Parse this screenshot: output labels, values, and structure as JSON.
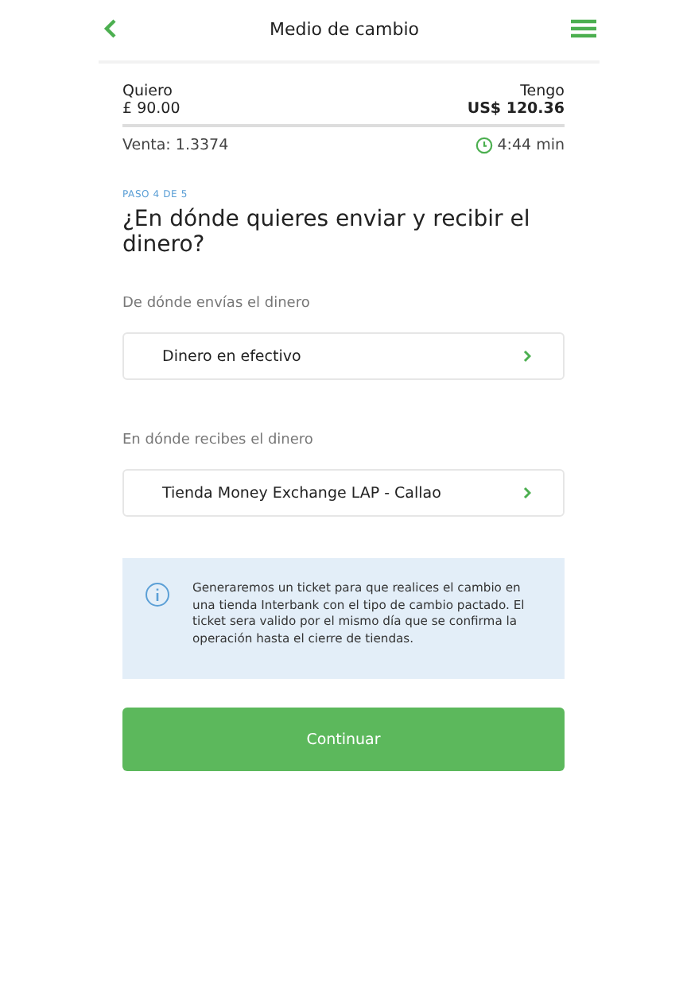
{
  "header": {
    "title": "Medio de cambio"
  },
  "summary": {
    "want_label": "Quiero",
    "want_amount": "£ 90.00",
    "have_label": "Tengo",
    "have_amount": "US$ 120.36",
    "rate": "Venta: 1.3374",
    "timer": "4:44 min"
  },
  "step": {
    "label": "PASO 4 DE 5",
    "title": "¿En dónde quieres enviar y recibir el dinero?"
  },
  "sections": [
    {
      "label": "De dónde envías el dinero",
      "option": "Dinero en efectivo"
    },
    {
      "label": "En dónde recibes el dinero",
      "option": "Tienda Money Exchange LAP - Callao"
    }
  ],
  "info": {
    "text": "Generaremos un ticket para que realices el cambio en una tienda Interbank con el tipo de cambio pactado. El ticket sera valido por el mismo día que se confirma la operación hasta el cierre de tiendas."
  },
  "button": {
    "label": "Continuar"
  }
}
